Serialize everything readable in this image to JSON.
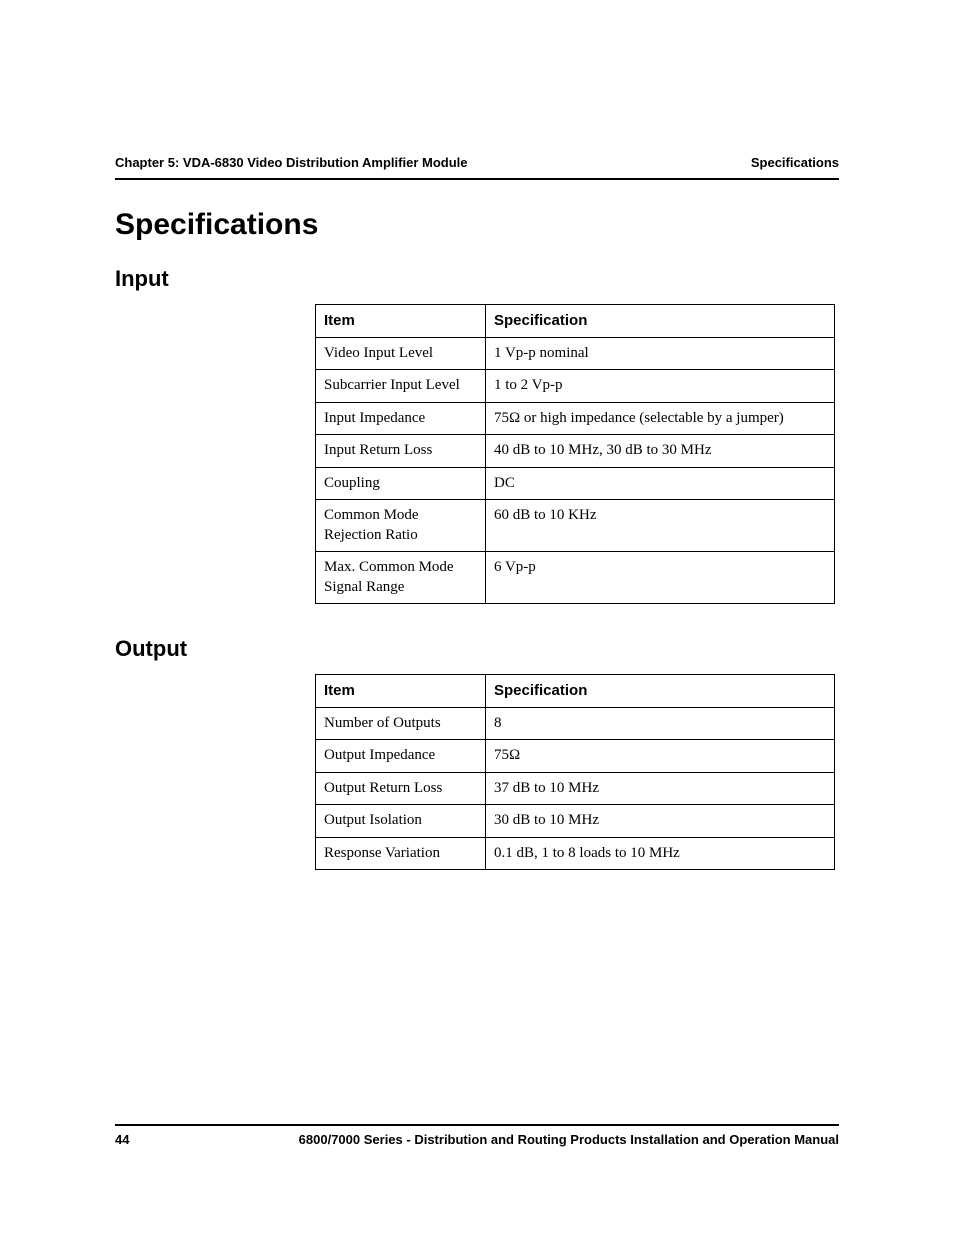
{
  "header": {
    "left": "Chapter 5: VDA-6830 Video Distribution Amplifier Module",
    "right": "Specifications"
  },
  "title": "Specifications",
  "sections": [
    {
      "heading": "Input",
      "columns": {
        "item": "Item",
        "spec": "Specification"
      },
      "rows": [
        {
          "item": "Video Input Level",
          "spec": "1 Vp-p nominal"
        },
        {
          "item": "Subcarrier Input Level",
          "spec": "1 to 2 Vp-p"
        },
        {
          "item": "Input Impedance",
          "spec": "75Ω or high impedance (selectable by a jumper)"
        },
        {
          "item": "Input Return Loss",
          "spec": "40 dB to 10 MHz, 30 dB to 30 MHz"
        },
        {
          "item": "Coupling",
          "spec": "DC"
        },
        {
          "item": "Common Mode Rejection Ratio",
          "spec": "60 dB to 10 KHz"
        },
        {
          "item": "Max. Common Mode Signal Range",
          "spec": "6 Vp-p"
        }
      ]
    },
    {
      "heading": "Output",
      "columns": {
        "item": "Item",
        "spec": "Specification"
      },
      "rows": [
        {
          "item": "Number of Outputs",
          "spec": "8"
        },
        {
          "item": "Output Impedance",
          "spec": "75Ω"
        },
        {
          "item": "Output Return Loss",
          "spec": "37 dB to 10 MHz"
        },
        {
          "item": "Output Isolation",
          "spec": "30 dB to 10 MHz"
        },
        {
          "item": "Response Variation",
          "spec": "0.1 dB, 1 to 8 loads to 10 MHz"
        }
      ]
    }
  ],
  "footer": {
    "page": "44",
    "text": "6800/7000 Series - Distribution and Routing Products Installation and Operation Manual"
  }
}
